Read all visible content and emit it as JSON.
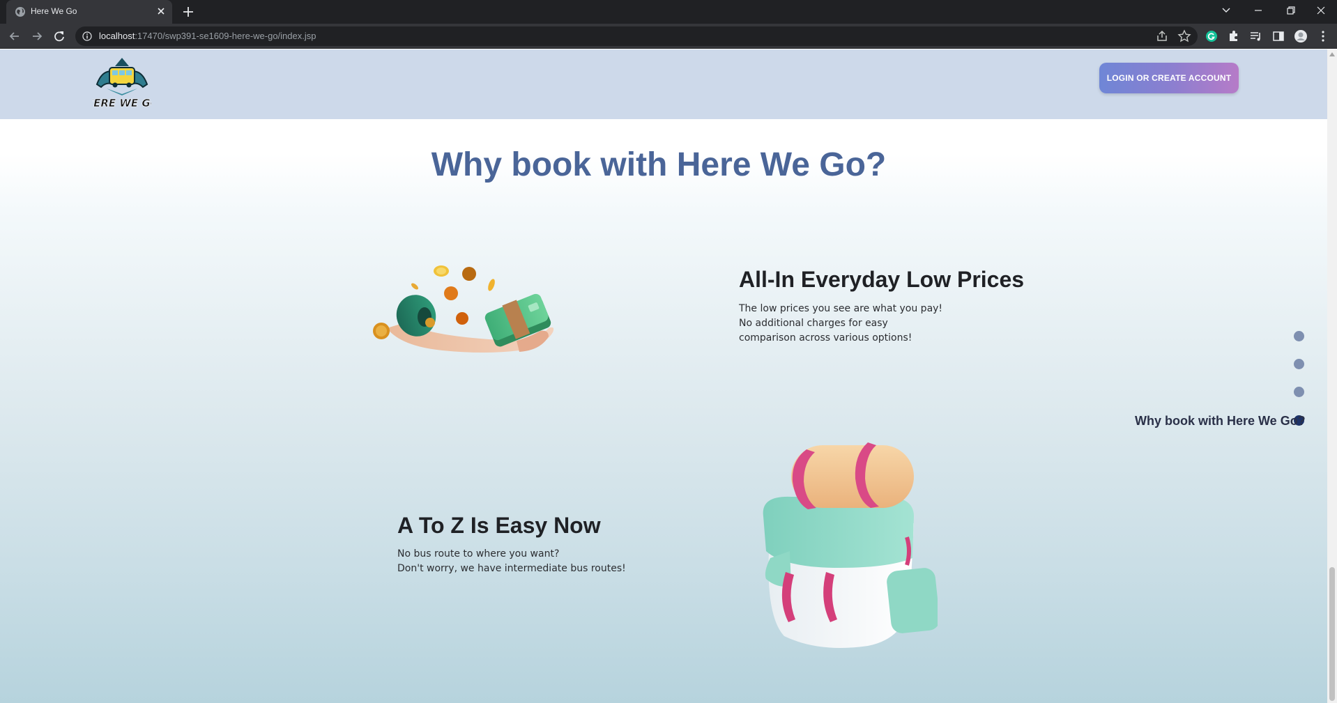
{
  "browser": {
    "tab_title": "Here We Go",
    "url_host": "localhost",
    "url_rest": ":17470/swp391-se1609-here-we-go/index.jsp"
  },
  "header": {
    "logo_text": "HERE WE GO",
    "login_label": "LOGIN OR CREATE ACCOUNT"
  },
  "section": {
    "title": "Why book with Here We Go?"
  },
  "features": [
    {
      "title": "All-In Everyday Low Prices",
      "lines": [
        "The low prices you see are what you pay!",
        "No additional charges for easy",
        "comparison across various options!"
      ]
    },
    {
      "title": "A To Z Is Easy Now",
      "lines": [
        "No bus route to where you want?",
        "Don't worry, we have intermediate bus routes!"
      ]
    }
  ],
  "dot_nav": {
    "active_label": "Why book with Here We Go?",
    "dots": 4,
    "active_index": 3
  },
  "colors": {
    "header_bg": "#cdd9ea",
    "title": "#4a6598",
    "button_gradient_start": "#6f86d6",
    "button_gradient_end": "#b67bc8",
    "dot": "#7e8fb0",
    "dot_active": "#1d3268"
  }
}
